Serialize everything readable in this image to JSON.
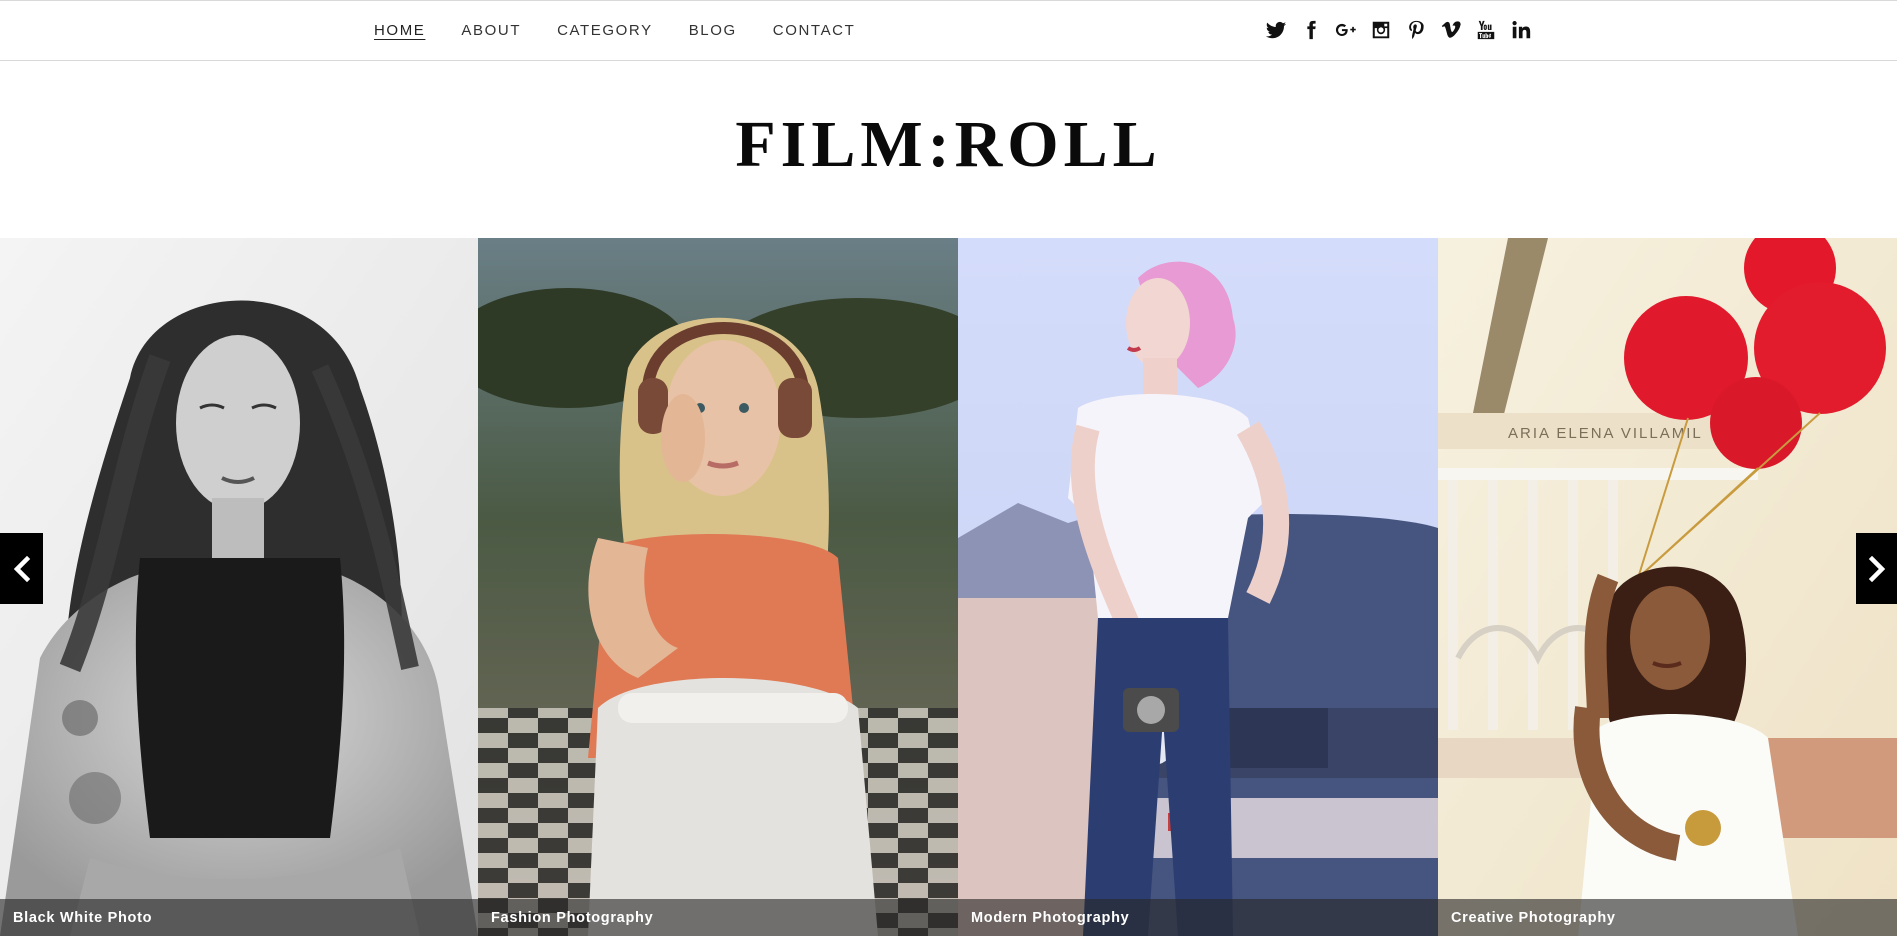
{
  "nav": {
    "items": [
      {
        "label": "HOME",
        "active": true
      },
      {
        "label": "ABOUT",
        "active": false
      },
      {
        "label": "CATEGORY",
        "active": false
      },
      {
        "label": "BLOG",
        "active": false
      },
      {
        "label": "CONTACT",
        "active": false
      }
    ]
  },
  "social": {
    "icons": [
      "twitter-icon",
      "facebook-icon",
      "google-plus-icon",
      "instagram-icon",
      "pinterest-icon",
      "vimeo-icon",
      "youtube-icon",
      "linkedin-icon"
    ]
  },
  "site": {
    "logo": "FILM:ROLL"
  },
  "slider": {
    "slides": [
      {
        "caption": "Black White Photo"
      },
      {
        "caption": "Fashion Photography"
      },
      {
        "caption": "Modern Photography"
      },
      {
        "caption": "Creative Photography"
      }
    ],
    "prev_icon": "chevron-left-icon",
    "next_icon": "chevron-right-icon"
  },
  "colors": {
    "text": "#333333",
    "logo": "#0a0a0a",
    "caption_bg": "#282828",
    "arrow_bg": "#000000"
  }
}
